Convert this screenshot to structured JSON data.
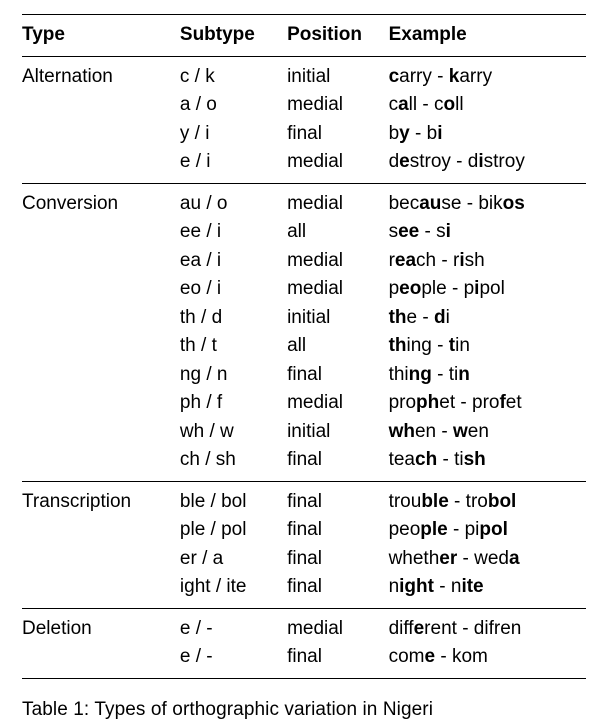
{
  "headers": {
    "type": "Type",
    "subtype": "Subtype",
    "position": "Position",
    "example": "Example"
  },
  "groups": [
    {
      "type": "Alternation",
      "rows": [
        {
          "subtype": "c / k",
          "position": "initial",
          "example_html": "<b>c</b>arry - <b>k</b>arry"
        },
        {
          "subtype": "a / o",
          "position": "medial",
          "example_html": "c<b>a</b>ll - c<b>o</b>ll"
        },
        {
          "subtype": "y / i",
          "position": "final",
          "example_html": "b<b>y</b> - b<b>i</b>"
        },
        {
          "subtype": "e / i",
          "position": "medial",
          "example_html": "d<b>e</b>stroy - d<b>i</b>stroy"
        }
      ]
    },
    {
      "type": "Conversion",
      "rows": [
        {
          "subtype": "au / o",
          "position": "medial",
          "example_html": "bec<b>au</b>se - bik<b>os</b>"
        },
        {
          "subtype": "ee / i",
          "position": "all",
          "example_html": "s<b>ee</b> - s<b>i</b>"
        },
        {
          "subtype": "ea / i",
          "position": "medial",
          "example_html": "r<b>ea</b>ch - r<b>i</b>sh"
        },
        {
          "subtype": "eo / i",
          "position": "medial",
          "example_html": "p<b>eo</b>ple - p<b>i</b>pol"
        },
        {
          "subtype": "th / d",
          "position": "initial",
          "example_html": "<b>th</b>e - <b>d</b>i"
        },
        {
          "subtype": "th / t",
          "position": "all",
          "example_html": "<b>th</b>ing - <b>t</b>in"
        },
        {
          "subtype": "ng / n",
          "position": "final",
          "example_html": "thi<b>ng</b> - ti<b>n</b>"
        },
        {
          "subtype": "ph / f",
          "position": "medial",
          "example_html": "pro<b>ph</b>et - pro<b>f</b>et"
        },
        {
          "subtype": "wh / w",
          "position": "initial",
          "example_html": "<b>wh</b>en - <b>w</b>en"
        },
        {
          "subtype": "ch / sh",
          "position": "final",
          "example_html": "tea<b>ch</b> - ti<b>sh</b>"
        }
      ]
    },
    {
      "type": "Transcription",
      "rows": [
        {
          "subtype": "ble / bol",
          "position": "final",
          "example_html": "trou<b>ble</b> - tro<b>bol</b>"
        },
        {
          "subtype": "ple / pol",
          "position": "final",
          "example_html": "peo<b>ple</b> - pi<b>pol</b>"
        },
        {
          "subtype": "er / a",
          "position": "final",
          "example_html": "wheth<b>er</b> - wed<b>a</b>"
        },
        {
          "subtype": "ight / ite",
          "position": "final",
          "example_html": "n<b>ight</b> - n<b>ite</b>"
        }
      ]
    },
    {
      "type": "Deletion",
      "rows": [
        {
          "subtype": "e / -",
          "position": "medial",
          "example_html": "diff<b>e</b>rent - difren"
        },
        {
          "subtype": "e / -",
          "position": "final",
          "example_html": "com<b>e</b> - kom"
        }
      ]
    }
  ],
  "caption_prefix": "Table 1: ",
  "caption_fragment": "Types of orthographic variation in Nigeri"
}
